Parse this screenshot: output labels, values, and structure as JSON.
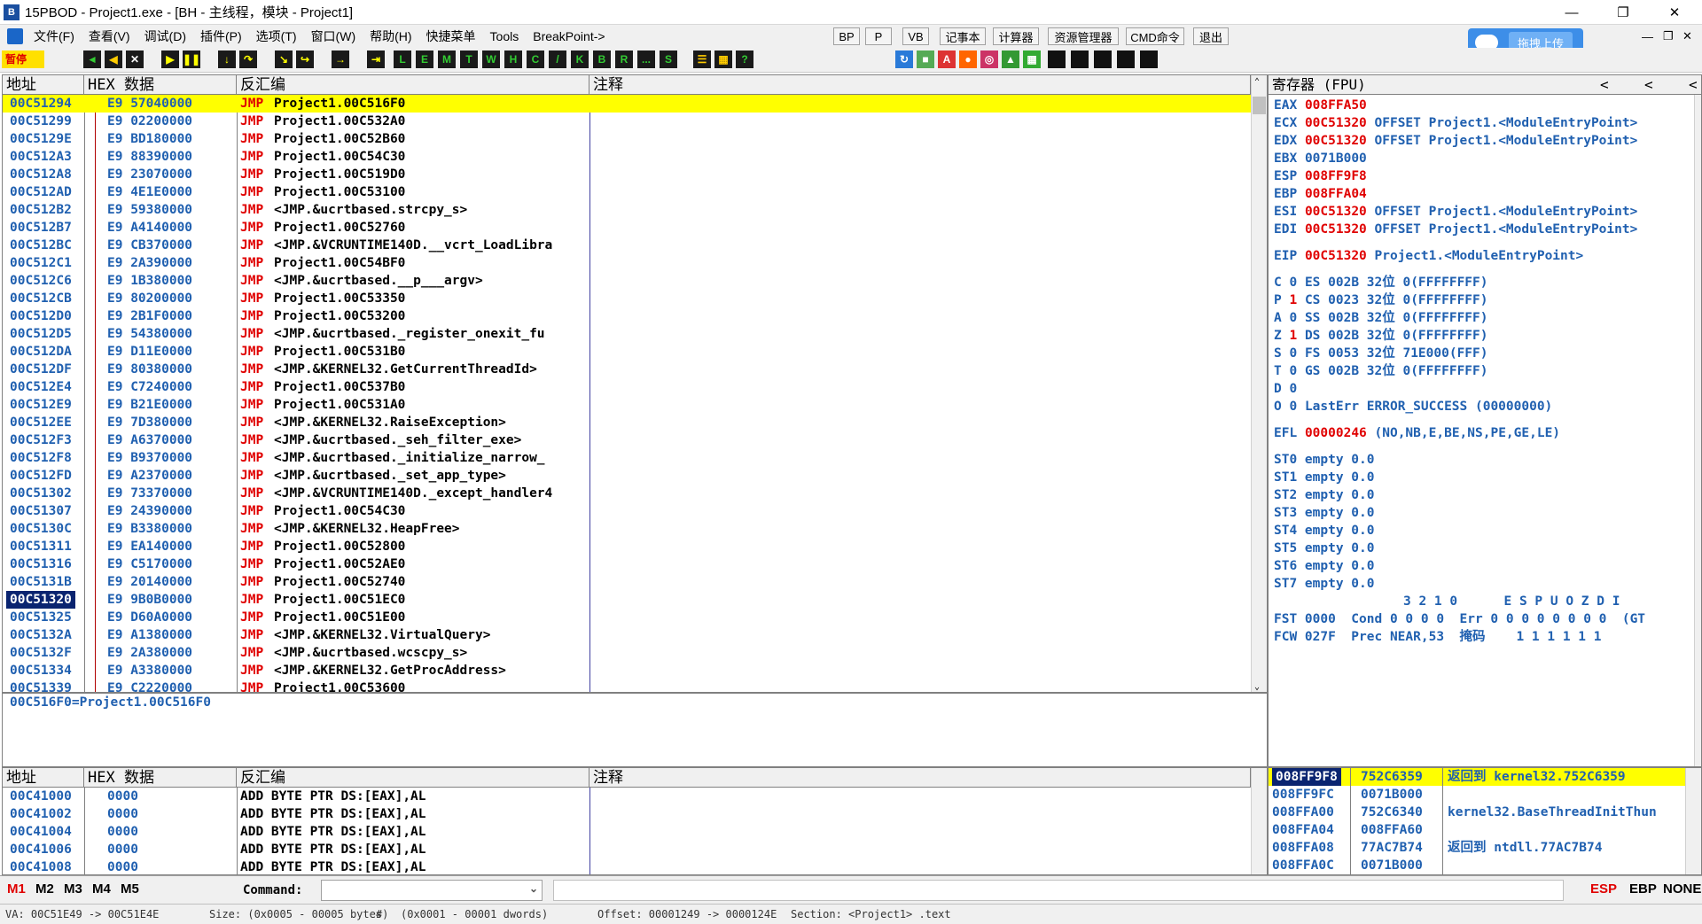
{
  "window": {
    "title": "15PBOD - Project1.exe - [BH - 主线程，模块 - Project1]",
    "icon_letter": "B"
  },
  "menu": {
    "items": [
      "文件(F)",
      "查看(V)",
      "调试(D)",
      "插件(P)",
      "选项(T)",
      "窗口(W)",
      "帮助(H)",
      "快捷菜单",
      "Tools",
      "BreakPoint->"
    ],
    "right_buttons": [
      "BP",
      "P",
      "VB",
      "记事本",
      "计算器",
      "资源管理器",
      "CMD命令",
      "退出"
    ]
  },
  "upload": {
    "label": "拖拽上传"
  },
  "toolbar": {
    "status": "暂停",
    "letter_buttons": [
      "L",
      "E",
      "M",
      "T",
      "W",
      "H",
      "C",
      "/",
      "K",
      "B",
      "R",
      "...",
      "S"
    ]
  },
  "cpu_pane": {
    "headers": [
      "地址",
      "HEX 数据",
      "反汇编",
      "注释"
    ],
    "rows": [
      {
        "addr": "00C51294",
        "hex": "E9 57040000",
        "op": "JMP",
        "arg": "Project1.00C516F0"
      },
      {
        "addr": "00C51299",
        "hex": "E9 02200000",
        "op": "JMP",
        "arg": "Project1.00C532A0"
      },
      {
        "addr": "00C5129E",
        "hex": "E9 BD180000",
        "op": "JMP",
        "arg": "Project1.00C52B60"
      },
      {
        "addr": "00C512A3",
        "hex": "E9 88390000",
        "op": "JMP",
        "arg": "Project1.00C54C30"
      },
      {
        "addr": "00C512A8",
        "hex": "E9 23070000",
        "op": "JMP",
        "arg": "Project1.00C519D0"
      },
      {
        "addr": "00C512AD",
        "hex": "E9 4E1E0000",
        "op": "JMP",
        "arg": "Project1.00C53100"
      },
      {
        "addr": "00C512B2",
        "hex": "E9 59380000",
        "op": "JMP",
        "arg": "<JMP.&ucrtbased.strcpy_s>"
      },
      {
        "addr": "00C512B7",
        "hex": "E9 A4140000",
        "op": "JMP",
        "arg": "Project1.00C52760"
      },
      {
        "addr": "00C512BC",
        "hex": "E9 CB370000",
        "op": "JMP",
        "arg": "<JMP.&VCRUNTIME140D.__vcrt_LoadLibra"
      },
      {
        "addr": "00C512C1",
        "hex": "E9 2A390000",
        "op": "JMP",
        "arg": "Project1.00C54BF0"
      },
      {
        "addr": "00C512C6",
        "hex": "E9 1B380000",
        "op": "JMP",
        "arg": "<JMP.&ucrtbased.__p___argv>"
      },
      {
        "addr": "00C512CB",
        "hex": "E9 80200000",
        "op": "JMP",
        "arg": "Project1.00C53350"
      },
      {
        "addr": "00C512D0",
        "hex": "E9 2B1F0000",
        "op": "JMP",
        "arg": "Project1.00C53200"
      },
      {
        "addr": "00C512D5",
        "hex": "E9 54380000",
        "op": "JMP",
        "arg": "<JMP.&ucrtbased._register_onexit_fu"
      },
      {
        "addr": "00C512DA",
        "hex": "E9 D11E0000",
        "op": "JMP",
        "arg": "Project1.00C531B0"
      },
      {
        "addr": "00C512DF",
        "hex": "E9 80380000",
        "op": "JMP",
        "arg": "<JMP.&KERNEL32.GetCurrentThreadId>"
      },
      {
        "addr": "00C512E4",
        "hex": "E9 C7240000",
        "op": "JMP",
        "arg": "Project1.00C537B0"
      },
      {
        "addr": "00C512E9",
        "hex": "E9 B21E0000",
        "op": "JMP",
        "arg": "Project1.00C531A0"
      },
      {
        "addr": "00C512EE",
        "hex": "E9 7D380000",
        "op": "JMP",
        "arg": "<JMP.&KERNEL32.RaiseException>"
      },
      {
        "addr": "00C512F3",
        "hex": "E9 A6370000",
        "op": "JMP",
        "arg": "<JMP.&ucrtbased._seh_filter_exe>"
      },
      {
        "addr": "00C512F8",
        "hex": "E9 B9370000",
        "op": "JMP",
        "arg": "<JMP.&ucrtbased._initialize_narrow_"
      },
      {
        "addr": "00C512FD",
        "hex": "E9 A2370000",
        "op": "JMP",
        "arg": "<JMP.&ucrtbased._set_app_type>"
      },
      {
        "addr": "00C51302",
        "hex": "E9 73370000",
        "op": "JMP",
        "arg": "<JMP.&VCRUNTIME140D._except_handler4"
      },
      {
        "addr": "00C51307",
        "hex": "E9 24390000",
        "op": "JMP",
        "arg": "Project1.00C54C30"
      },
      {
        "addr": "00C5130C",
        "hex": "E9 B3380000",
        "op": "JMP",
        "arg": "<JMP.&KERNEL32.HeapFree>"
      },
      {
        "addr": "00C51311",
        "hex": "E9 EA140000",
        "op": "JMP",
        "arg": "Project1.00C52800"
      },
      {
        "addr": "00C51316",
        "hex": "E9 C5170000",
        "op": "JMP",
        "arg": "Project1.00C52AE0"
      },
      {
        "addr": "00C5131B",
        "hex": "E9 20140000",
        "op": "JMP",
        "arg": "Project1.00C52740"
      },
      {
        "addr": "00C51320",
        "hex": "E9 9B0B0000",
        "op": "JMP",
        "arg": "Project1.00C51EC0"
      },
      {
        "addr": "00C51325",
        "hex": "E9 D60A0000",
        "op": "JMP",
        "arg": "Project1.00C51E00"
      },
      {
        "addr": "00C5132A",
        "hex": "E9 A1380000",
        "op": "JMP",
        "arg": "<JMP.&KERNEL32.VirtualQuery>"
      },
      {
        "addr": "00C5132F",
        "hex": "E9 2A380000",
        "op": "JMP",
        "arg": "<JMP.&ucrtbased.wcscpy_s>"
      },
      {
        "addr": "00C51334",
        "hex": "E9 A3380000",
        "op": "JMP",
        "arg": "<JMP.&KERNEL32.GetProcAddress>"
      },
      {
        "addr": "00C51339",
        "hex": "E9 C2220000",
        "op": "JMP",
        "arg": "Project1.00C53600"
      }
    ],
    "info_line": "00C516F0=Project1.00C516F0"
  },
  "registers": {
    "header": "寄存器 (FPU)",
    "gp": [
      {
        "name": "EAX",
        "val": "008FFA50",
        "note": ""
      },
      {
        "name": "ECX",
        "val": "00C51320",
        "note": "OFFSET Project1.<ModuleEntryPoint>"
      },
      {
        "name": "EDX",
        "val": "00C51320",
        "note": "OFFSET Project1.<ModuleEntryPoint>"
      },
      {
        "name": "EBX",
        "val": "0071B000",
        "note": ""
      },
      {
        "name": "ESP",
        "val": "008FF9F8",
        "note": ""
      },
      {
        "name": "EBP",
        "val": "008FFA04",
        "note": ""
      },
      {
        "name": "ESI",
        "val": "00C51320",
        "note": "OFFSET Project1.<ModuleEntryPoint>"
      },
      {
        "name": "EDI",
        "val": "00C51320",
        "note": "OFFSET Project1.<ModuleEntryPoint>"
      }
    ],
    "eip": {
      "name": "EIP",
      "val": "00C51320",
      "note": "Project1.<ModuleEntryPoint>"
    },
    "flags": [
      {
        "f": "C",
        "v": "0",
        "seg": "ES 002B 32位 0(FFFFFFFF)"
      },
      {
        "f": "P",
        "v": "1",
        "seg": "CS 0023 32位 0(FFFFFFFF)"
      },
      {
        "f": "A",
        "v": "0",
        "seg": "SS 002B 32位 0(FFFFFFFF)"
      },
      {
        "f": "Z",
        "v": "1",
        "seg": "DS 002B 32位 0(FFFFFFFF)"
      },
      {
        "f": "S",
        "v": "0",
        "seg": "FS 0053 32位 71E000(FFF)"
      },
      {
        "f": "T",
        "v": "0",
        "seg": "GS 002B 32位 0(FFFFFFFF)"
      },
      {
        "f": "D",
        "v": "0",
        "seg": ""
      },
      {
        "f": "O",
        "v": "0",
        "seg": "LastErr ERROR_SUCCESS (00000000)"
      }
    ],
    "efl": {
      "name": "EFL",
      "val": "00000246",
      "note": "(NO,NB,E,BE,NS,PE,GE,LE)"
    },
    "st": [
      "ST0 empty 0.0",
      "ST1 empty 0.0",
      "ST2 empty 0.0",
      "ST3 empty 0.0",
      "ST4 empty 0.0",
      "ST5 empty 0.0",
      "ST6 empty 0.0",
      "ST7 empty 0.0"
    ],
    "fpu_header": "3 2 1 0      E S P U O Z D I",
    "fst": "FST 0000  Cond 0 0 0 0  Err 0 0 0 0 0 0 0 0  (GT",
    "fcw_a": "FCW 027F  Prec NEAR,53",
    "fcw_b": "掩码",
    "fcw_c": "1 1 1 1 1 1"
  },
  "dump_pane": {
    "headers": [
      "地址",
      "HEX 数据",
      "反汇编",
      "注释"
    ],
    "rows": [
      {
        "addr": "00C41000",
        "hex": "0000",
        "dis": "ADD BYTE PTR DS:[EAX],AL"
      },
      {
        "addr": "00C41002",
        "hex": "0000",
        "dis": "ADD BYTE PTR DS:[EAX],AL"
      },
      {
        "addr": "00C41004",
        "hex": "0000",
        "dis": "ADD BYTE PTR DS:[EAX],AL"
      },
      {
        "addr": "00C41006",
        "hex": "0000",
        "dis": "ADD BYTE PTR DS:[EAX],AL"
      },
      {
        "addr": "00C41008",
        "hex": "0000",
        "dis": "ADD BYTE PTR DS:[EAX],AL"
      }
    ]
  },
  "stack_pane": {
    "rows": [
      {
        "addr": "008FF9F8",
        "val": "752C6359",
        "note": "返回到 kernel32.752C6359"
      },
      {
        "addr": "008FF9FC",
        "val": "0071B000",
        "note": ""
      },
      {
        "addr": "008FFA00",
        "val": "752C6340",
        "note": "kernel32.BaseThreadInitThun"
      },
      {
        "addr": "008FFA04",
        "val": "008FFA60",
        "note": ""
      },
      {
        "addr": "008FFA08",
        "val": "77AC7B74",
        "note": "返回到 ntdll.77AC7B74"
      },
      {
        "addr": "008FFA0C",
        "val": "0071B000",
        "note": ""
      }
    ]
  },
  "cmdbar": {
    "marks": [
      "M1",
      "M2",
      "M3",
      "M4",
      "M5"
    ],
    "command_label": "Command:",
    "right": [
      "ESP",
      "EBP",
      "NONE"
    ]
  },
  "status": {
    "va": "VA: 00C51E49 -> 00C51E4E",
    "size": "Size: (0x0005 - 00005 bytes)",
    "hash": "#",
    "dwords": "(0x0001 - 00001 dwords)",
    "offset": "Offset: 00001249 -> 0000124E",
    "section": "Section: <Project1> .text"
  }
}
